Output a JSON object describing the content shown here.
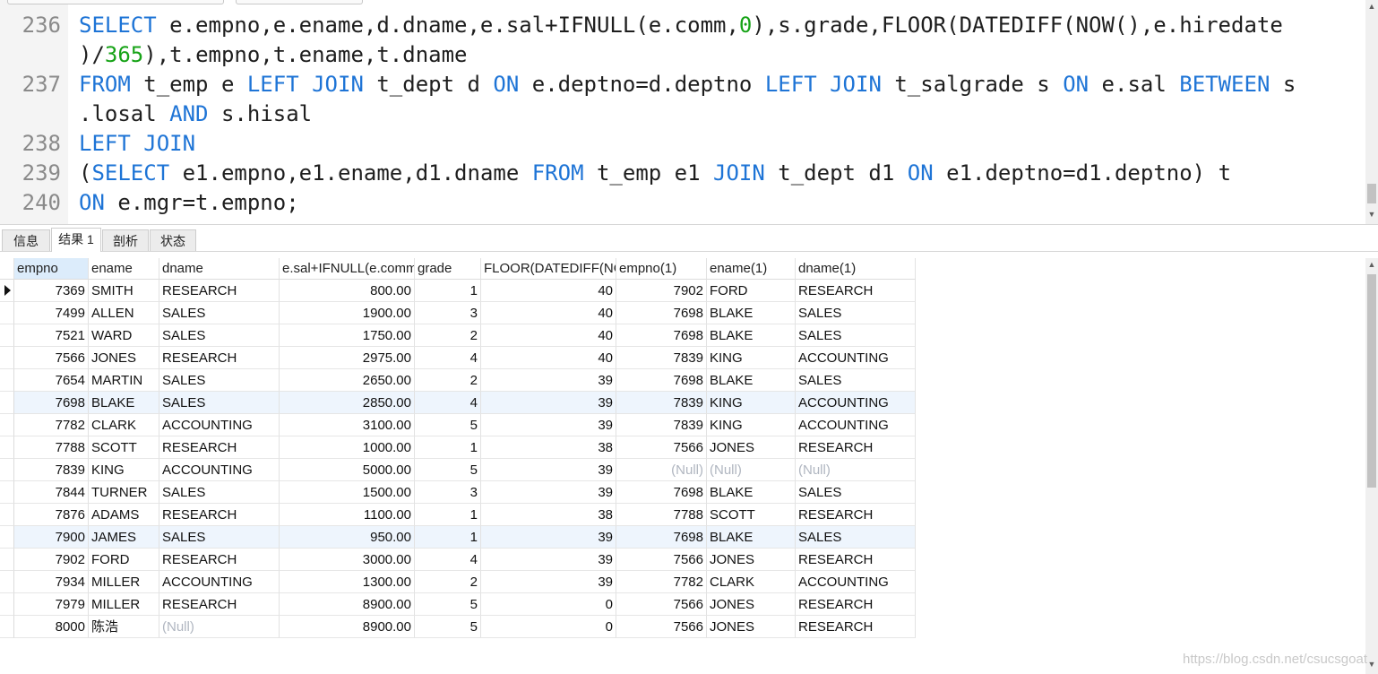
{
  "editor": {
    "lines": [
      {
        "num": "236",
        "segs": [
          {
            "t": "SELECT",
            "c": "kw"
          },
          {
            "t": " e.empno,e.ename,d.dname,e.sal+IFNULL(e.comm,"
          },
          {
            "t": "0",
            "c": "num"
          },
          {
            "t": "),s.grade,FLOOR(DATEDIFF(NOW(),e.hiredate"
          }
        ]
      },
      {
        "num": "",
        "segs": [
          {
            "t": ")/"
          },
          {
            "t": "365",
            "c": "num"
          },
          {
            "t": "),t.empno,t.ename,t.dname"
          }
        ]
      },
      {
        "num": "237",
        "segs": [
          {
            "t": "FROM",
            "c": "kw"
          },
          {
            "t": " t_emp e "
          },
          {
            "t": "LEFT JOIN",
            "c": "kw"
          },
          {
            "t": " t_dept d "
          },
          {
            "t": "ON",
            "c": "kw"
          },
          {
            "t": " e.deptno=d.deptno "
          },
          {
            "t": "LEFT JOIN",
            "c": "kw"
          },
          {
            "t": " t_salgrade s "
          },
          {
            "t": "ON",
            "c": "kw"
          },
          {
            "t": " e.sal "
          },
          {
            "t": "BETWEEN",
            "c": "kw"
          },
          {
            "t": " s"
          }
        ]
      },
      {
        "num": "",
        "segs": [
          {
            "t": ".losal "
          },
          {
            "t": "AND",
            "c": "kw"
          },
          {
            "t": " s.hisal"
          }
        ]
      },
      {
        "num": "238",
        "segs": [
          {
            "t": "LEFT JOIN",
            "c": "kw"
          }
        ]
      },
      {
        "num": "239",
        "segs": [
          {
            "t": "("
          },
          {
            "t": "SELECT",
            "c": "kw"
          },
          {
            "t": " e1.empno,e1.ename,d1.dname "
          },
          {
            "t": "FROM",
            "c": "kw"
          },
          {
            "t": " t_emp e1 "
          },
          {
            "t": "JOIN",
            "c": "kw"
          },
          {
            "t": " t_dept d1 "
          },
          {
            "t": "ON",
            "c": "kw"
          },
          {
            "t": " e1.deptno=d1.deptno) t"
          }
        ]
      },
      {
        "num": "240",
        "segs": [
          {
            "t": "ON",
            "c": "kw"
          },
          {
            "t": " e.mgr=t.empno;"
          }
        ]
      }
    ]
  },
  "tabs": [
    "信息",
    "结果 1",
    "剖析",
    "状态"
  ],
  "active_tab": "结果 1",
  "grid": {
    "columns": [
      "empno",
      "ename",
      "dname",
      "e.sal+IFNULL(e.comm",
      "grade",
      "FLOOR(DATEDIFF(NO",
      "empno(1)",
      "ename(1)",
      "dname(1)"
    ],
    "null_text": "(Null)",
    "rows": [
      [
        "7369",
        "SMITH",
        "RESEARCH",
        "800.00",
        "1",
        "40",
        "7902",
        "FORD",
        "RESEARCH"
      ],
      [
        "7499",
        "ALLEN",
        "SALES",
        "1900.00",
        "3",
        "40",
        "7698",
        "BLAKE",
        "SALES"
      ],
      [
        "7521",
        "WARD",
        "SALES",
        "1750.00",
        "2",
        "40",
        "7698",
        "BLAKE",
        "SALES"
      ],
      [
        "7566",
        "JONES",
        "RESEARCH",
        "2975.00",
        "4",
        "40",
        "7839",
        "KING",
        "ACCOUNTING"
      ],
      [
        "7654",
        "MARTIN",
        "SALES",
        "2650.00",
        "2",
        "39",
        "7698",
        "BLAKE",
        "SALES"
      ],
      [
        "7698",
        "BLAKE",
        "SALES",
        "2850.00",
        "4",
        "39",
        "7839",
        "KING",
        "ACCOUNTING"
      ],
      [
        "7782",
        "CLARK",
        "ACCOUNTING",
        "3100.00",
        "5",
        "39",
        "7839",
        "KING",
        "ACCOUNTING"
      ],
      [
        "7788",
        "SCOTT",
        "RESEARCH",
        "1000.00",
        "1",
        "38",
        "7566",
        "JONES",
        "RESEARCH"
      ],
      [
        "7839",
        "KING",
        "ACCOUNTING",
        "5000.00",
        "5",
        "39",
        null,
        null,
        null
      ],
      [
        "7844",
        "TURNER",
        "SALES",
        "1500.00",
        "3",
        "39",
        "7698",
        "BLAKE",
        "SALES"
      ],
      [
        "7876",
        "ADAMS",
        "RESEARCH",
        "1100.00",
        "1",
        "38",
        "7788",
        "SCOTT",
        "RESEARCH"
      ],
      [
        "7900",
        "JAMES",
        "SALES",
        "950.00",
        "1",
        "39",
        "7698",
        "BLAKE",
        "SALES"
      ],
      [
        "7902",
        "FORD",
        "RESEARCH",
        "3000.00",
        "4",
        "39",
        "7566",
        "JONES",
        "RESEARCH"
      ],
      [
        "7934",
        "MILLER",
        "ACCOUNTING",
        "1300.00",
        "2",
        "39",
        "7782",
        "CLARK",
        "ACCOUNTING"
      ],
      [
        "7979",
        "MILLER",
        "RESEARCH",
        "8900.00",
        "5",
        "0",
        "7566",
        "JONES",
        "RESEARCH"
      ],
      [
        "8000",
        "陈浩",
        null,
        "8900.00",
        "5",
        "0",
        "7566",
        "JONES",
        "RESEARCH"
      ]
    ],
    "highlighted_rows": [
      5,
      11
    ],
    "current_row": 0
  },
  "watermark": "https://blog.csdn.net/csucsgoat",
  "colors": {
    "keyword": "#1e74d6",
    "number": "#17a317",
    "null": "#b0b6c0",
    "header_selected": "#dcecfb",
    "row_highlight": "#eef5fd"
  }
}
